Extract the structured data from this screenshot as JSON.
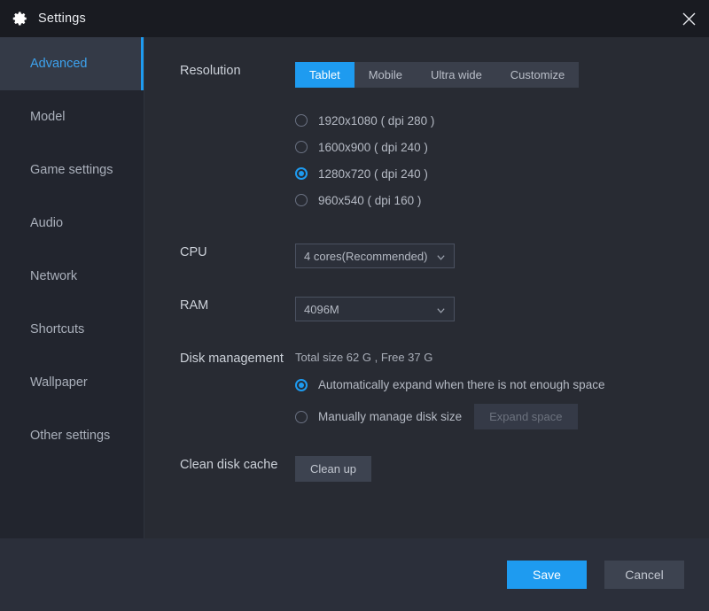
{
  "window": {
    "title": "Settings",
    "gear_icon": "gear-icon",
    "close_icon": "close-icon"
  },
  "sidebar": {
    "items": [
      {
        "label": "Advanced",
        "active": true
      },
      {
        "label": "Model",
        "active": false
      },
      {
        "label": "Game settings",
        "active": false
      },
      {
        "label": "Audio",
        "active": false
      },
      {
        "label": "Network",
        "active": false
      },
      {
        "label": "Shortcuts",
        "active": false
      },
      {
        "label": "Wallpaper",
        "active": false
      },
      {
        "label": "Other settings",
        "active": false
      }
    ]
  },
  "main": {
    "resolution": {
      "label": "Resolution",
      "tabs": [
        {
          "label": "Tablet",
          "active": true
        },
        {
          "label": "Mobile",
          "active": false
        },
        {
          "label": "Ultra wide",
          "active": false
        },
        {
          "label": "Customize",
          "active": false
        }
      ],
      "options": [
        {
          "label": "1920x1080 ( dpi 280 )",
          "selected": false
        },
        {
          "label": "1600x900 ( dpi 240 )",
          "selected": false
        },
        {
          "label": "1280x720 ( dpi 240 )",
          "selected": true
        },
        {
          "label": "960x540 ( dpi 160 )",
          "selected": false
        }
      ]
    },
    "cpu": {
      "label": "CPU",
      "value": "4 cores(Recommended)",
      "chevron_icon": "chevron-down-icon"
    },
    "ram": {
      "label": "RAM",
      "value": "4096M",
      "chevron_icon": "chevron-down-icon"
    },
    "disk": {
      "label": "Disk management",
      "info": "Total size 62 G , Free 37 G",
      "options": [
        {
          "label": "Automatically expand when there is not enough space",
          "selected": true
        },
        {
          "label": "Manually manage disk size",
          "selected": false
        }
      ],
      "expand_button": "Expand space"
    },
    "cache": {
      "label": "Clean disk cache",
      "button": "Clean up"
    }
  },
  "footer": {
    "save_label": "Save",
    "cancel_label": "Cancel"
  },
  "colors": {
    "accent": "#1e9bf0",
    "titlebar_bg": "#191b21",
    "sidebar_bg": "#22252e",
    "content_bg": "#282b33",
    "footer_bg": "#2b2f3a",
    "button_grey": "#3d4350"
  }
}
